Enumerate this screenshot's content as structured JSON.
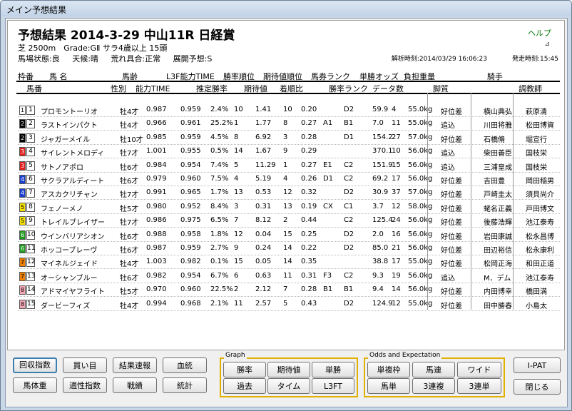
{
  "window": {
    "title": "メイン予想結果"
  },
  "header": {
    "title": "予想結果 2014-3-29 中山11R 日経賞",
    "help": "ヘルプ",
    "pin": "⊿",
    "race_info": "芝 2500m　Grade:GⅡ サラ4歳以上 15頭",
    "conditions": [
      "馬場状態:良",
      "天候:晴",
      "荒れ具合:正常",
      "展開予想:S"
    ],
    "calc_time": "解析時刻:2014/03/29 16:06:23",
    "depart_time": "発走時刻:15:45"
  },
  "columns_top": {
    "gate": "枠番",
    "name": "馬 名",
    "age": "馬齢",
    "l3f": "L3F能力TIME",
    "win_rank": "勝率順位",
    "exp_rank": "期待値順位",
    "ticket_rank": "馬券ランク",
    "win_odds": "単勝オッズ",
    "weight": "負担重量",
    "jockey": "騎手"
  },
  "columns_bottom": {
    "num": "馬番",
    "sex": "性別",
    "ability": "能力TIME",
    "est_win": "推定勝率",
    "exp": "期待値",
    "margin": "着順比",
    "win_rank2": "勝率ランク",
    "data_count": "データ数",
    "style": "脚質",
    "trainer": "調教師"
  },
  "horses": [
    {
      "gate": "1",
      "gc": "#ffffff",
      "gt": "#000000",
      "num": "1",
      "name": "プロモントーリオ",
      "sex": "牡",
      "age": "4才",
      "ab": "0.987",
      "l3": "0.959",
      "pct": "2.4%",
      "wr": "10",
      "ev": "1.41",
      "er": "10",
      "mg": "0.20",
      "tr": "",
      "wr2": "D2",
      "odds": "59.9",
      "dc": "4",
      "wt": "55.0kg",
      "st": "好位差",
      "jk": "横山典弘",
      "tn": "萩原清"
    },
    {
      "gate": "2",
      "gc": "#000000",
      "gt": "#ffffff",
      "num": "2",
      "name": "ラストインパクト",
      "sex": "牡",
      "age": "4才",
      "ab": "0.966",
      "l3": "0.961",
      "pct": "25.2%",
      "wr": "1",
      "ev": "1.77",
      "er": "8",
      "mg": "0.27",
      "tr": "A1",
      "wr2": "B1",
      "odds": "7.0",
      "dc": "11",
      "wt": "55.0kg",
      "st": "追込",
      "jk": "川田将雅",
      "tn": "松田博資"
    },
    {
      "gate": "2",
      "gc": "#000000",
      "gt": "#ffffff",
      "num": "3",
      "name": "ジャガーメイル",
      "sex": "牡",
      "age": "10才",
      "ab": "0.985",
      "l3": "0.959",
      "pct": "4.5%",
      "wr": "8",
      "ev": "6.92",
      "er": "3",
      "mg": "0.28",
      "tr": "",
      "wr2": "D1",
      "odds": "154.2",
      "dc": "27",
      "wt": "57.0kg",
      "st": "好位差",
      "jk": "石橋脩",
      "tn": "堀宣行"
    },
    {
      "gate": "3",
      "gc": "#e02020",
      "gt": "#ffffff",
      "num": "4",
      "name": "サイレントメロディ",
      "sex": "牡",
      "age": "7才",
      "ab": "1.001",
      "l3": "0.955",
      "pct": "0.5%",
      "wr": "14",
      "ev": "1.67",
      "er": "9",
      "mg": "0.29",
      "tr": "",
      "wr2": "",
      "odds": "370.1",
      "dc": "10",
      "wt": "56.0kg",
      "st": "追込",
      "jk": "柴田善臣",
      "tn": "国枝栄"
    },
    {
      "gate": "3",
      "gc": "#e02020",
      "gt": "#ffffff",
      "num": "5",
      "name": "サトノアポロ",
      "sex": "牡",
      "age": "6才",
      "ab": "0.984",
      "l3": "0.954",
      "pct": "7.4%",
      "wr": "5",
      "ev": "11.29",
      "er": "1",
      "mg": "0.27",
      "tr": "E1",
      "wr2": "C2",
      "odds": "151.9",
      "dc": "15",
      "wt": "56.0kg",
      "st": "追込",
      "jk": "三浦皇成",
      "tn": "国枝栄"
    },
    {
      "gate": "4",
      "gc": "#1a3fd0",
      "gt": "#ffffff",
      "num": "6",
      "name": "サクラアルディート",
      "sex": "牡",
      "age": "6才",
      "ab": "0.979",
      "l3": "0.960",
      "pct": "7.5%",
      "wr": "4",
      "ev": "5.19",
      "er": "4",
      "mg": "0.26",
      "tr": "D1",
      "wr2": "C2",
      "odds": "69.2",
      "dc": "17",
      "wt": "56.0kg",
      "st": "好位差",
      "jk": "吉田豊",
      "tn": "岡田稲男"
    },
    {
      "gate": "4",
      "gc": "#1a3fd0",
      "gt": "#ffffff",
      "num": "7",
      "name": "アスカクリチャン",
      "sex": "牡",
      "age": "7才",
      "ab": "0.991",
      "l3": "0.965",
      "pct": "1.7%",
      "wr": "13",
      "ev": "0.53",
      "er": "12",
      "mg": "0.32",
      "tr": "",
      "wr2": "D2",
      "odds": "30.9",
      "dc": "37",
      "wt": "57.0kg",
      "st": "好位差",
      "jk": "戸崎圭太",
      "tn": "須貝尚介"
    },
    {
      "gate": "5",
      "gc": "#f5e000",
      "gt": "#000000",
      "num": "8",
      "name": "フェノーメノ",
      "sex": "牡",
      "age": "5才",
      "ab": "0.980",
      "l3": "0.952",
      "pct": "8.4%",
      "wr": "3",
      "ev": "0.31",
      "er": "13",
      "mg": "0.19",
      "tr": "CX",
      "wr2": "C1",
      "odds": "3.7",
      "dc": "12",
      "wt": "58.0kg",
      "st": "好位差",
      "jk": "蛯名正義",
      "tn": "戸田博文"
    },
    {
      "gate": "5",
      "gc": "#f5e000",
      "gt": "#000000",
      "num": "9",
      "name": "トレイルブレイザー",
      "sex": "牡",
      "age": "7才",
      "ab": "0.986",
      "l3": "0.975",
      "pct": "6.5%",
      "wr": "7",
      "ev": "8.12",
      "er": "2",
      "mg": "0.44",
      "tr": "",
      "wr2": "C2",
      "odds": "125.4",
      "dc": "24",
      "wt": "56.0kg",
      "st": "好位差",
      "jk": "後藤浩輝",
      "tn": "池江泰寿"
    },
    {
      "gate": "6",
      "gc": "#1e9a1e",
      "gt": "#ffffff",
      "num": "10",
      "name": "ウインバリアシオン",
      "sex": "牡",
      "age": "6才",
      "ab": "0.988",
      "l3": "0.958",
      "pct": "1.8%",
      "wr": "12",
      "ev": "0.04",
      "er": "15",
      "mg": "0.25",
      "tr": "",
      "wr2": "D2",
      "odds": "2.0",
      "dc": "16",
      "wt": "56.0kg",
      "st": "好位差",
      "jk": "岩田康誠",
      "tn": "松永昌博"
    },
    {
      "gate": "6",
      "gc": "#1e9a1e",
      "gt": "#ffffff",
      "num": "11",
      "name": "ホッコーブレーヴ",
      "sex": "牡",
      "age": "6才",
      "ab": "0.987",
      "l3": "0.959",
      "pct": "2.7%",
      "wr": "9",
      "ev": "0.24",
      "er": "14",
      "mg": "0.22",
      "tr": "",
      "wr2": "D2",
      "odds": "85.0",
      "dc": "21",
      "wt": "56.0kg",
      "st": "好位差",
      "jk": "田辺裕信",
      "tn": "松永康利"
    },
    {
      "gate": "7",
      "gc": "#f08000",
      "gt": "#000000",
      "num": "12",
      "name": "マイネルジェイド",
      "sex": "牡",
      "age": "4才",
      "ab": "1.003",
      "l3": "0.982",
      "pct": "0.1%",
      "wr": "15",
      "ev": "0.05",
      "er": "14",
      "mg": "0.35",
      "tr": "",
      "wr2": "",
      "odds": "38.8",
      "dc": "17",
      "wt": "55.0kg",
      "st": "好位差",
      "jk": "松岡正海",
      "tn": "和田正道"
    },
    {
      "gate": "7",
      "gc": "#f08000",
      "gt": "#000000",
      "num": "13",
      "name": "オーシャンブルー",
      "sex": "牡",
      "age": "6才",
      "ab": "0.982",
      "l3": "0.954",
      "pct": "6.7%",
      "wr": "6",
      "ev": "0.63",
      "er": "11",
      "mg": "0.31",
      "tr": "F3",
      "wr2": "C2",
      "odds": "9.3",
      "dc": "19",
      "wt": "56.0kg",
      "st": "追込",
      "jk": "M．デム",
      "tn": "池江泰寿"
    },
    {
      "gate": "8",
      "gc": "#f4a6b4",
      "gt": "#000000",
      "num": "14",
      "name": "アドマイヤフライト",
      "sex": "牡",
      "age": "5才",
      "ab": "0.970",
      "l3": "0.960",
      "pct": "22.5%",
      "wr": "2",
      "ev": "2.12",
      "er": "7",
      "mg": "0.28",
      "tr": "B1",
      "wr2": "B1",
      "odds": "9.4",
      "dc": "14",
      "wt": "56.0kg",
      "st": "好位差",
      "jk": "内田博幸",
      "tn": "橋田満"
    },
    {
      "gate": "8",
      "gc": "#f4a6b4",
      "gt": "#000000",
      "num": "15",
      "name": "ダービーフィズ",
      "sex": "牡",
      "age": "4才",
      "ab": "0.994",
      "l3": "0.968",
      "pct": "2.1%",
      "wr": "11",
      "ev": "2.57",
      "er": "5",
      "mg": "0.43",
      "tr": "",
      "wr2": "D2",
      "odds": "124.9",
      "dc": "12",
      "wt": "55.0kg",
      "st": "好位差",
      "jk": "田中勝春",
      "tn": "小島太"
    }
  ],
  "buttons_left": {
    "kaishu": "回収指数",
    "kaime": "買い目",
    "kekka": "結果速報",
    "ketto": "血統",
    "bataiju": "馬体重",
    "tekisei": "適性指数",
    "senseki": "戦績",
    "tokei": "統計"
  },
  "graph": {
    "label": "Graph",
    "shoritsu": "勝率",
    "kitaichi": "期待値",
    "tansho": "単勝",
    "kako": "過去",
    "time": "タイム",
    "l3ft": "L3FT"
  },
  "odds": {
    "label": "Odds and Expectation",
    "tanfuku": "単複枠",
    "umaren": "馬連",
    "wide": "ワイド",
    "umatan": "馬単",
    "sanrenpuku": "3連複",
    "sanrentan": "3連単"
  },
  "buttons_right": {
    "ipat": "I-PAT",
    "close": "閉じる"
  }
}
